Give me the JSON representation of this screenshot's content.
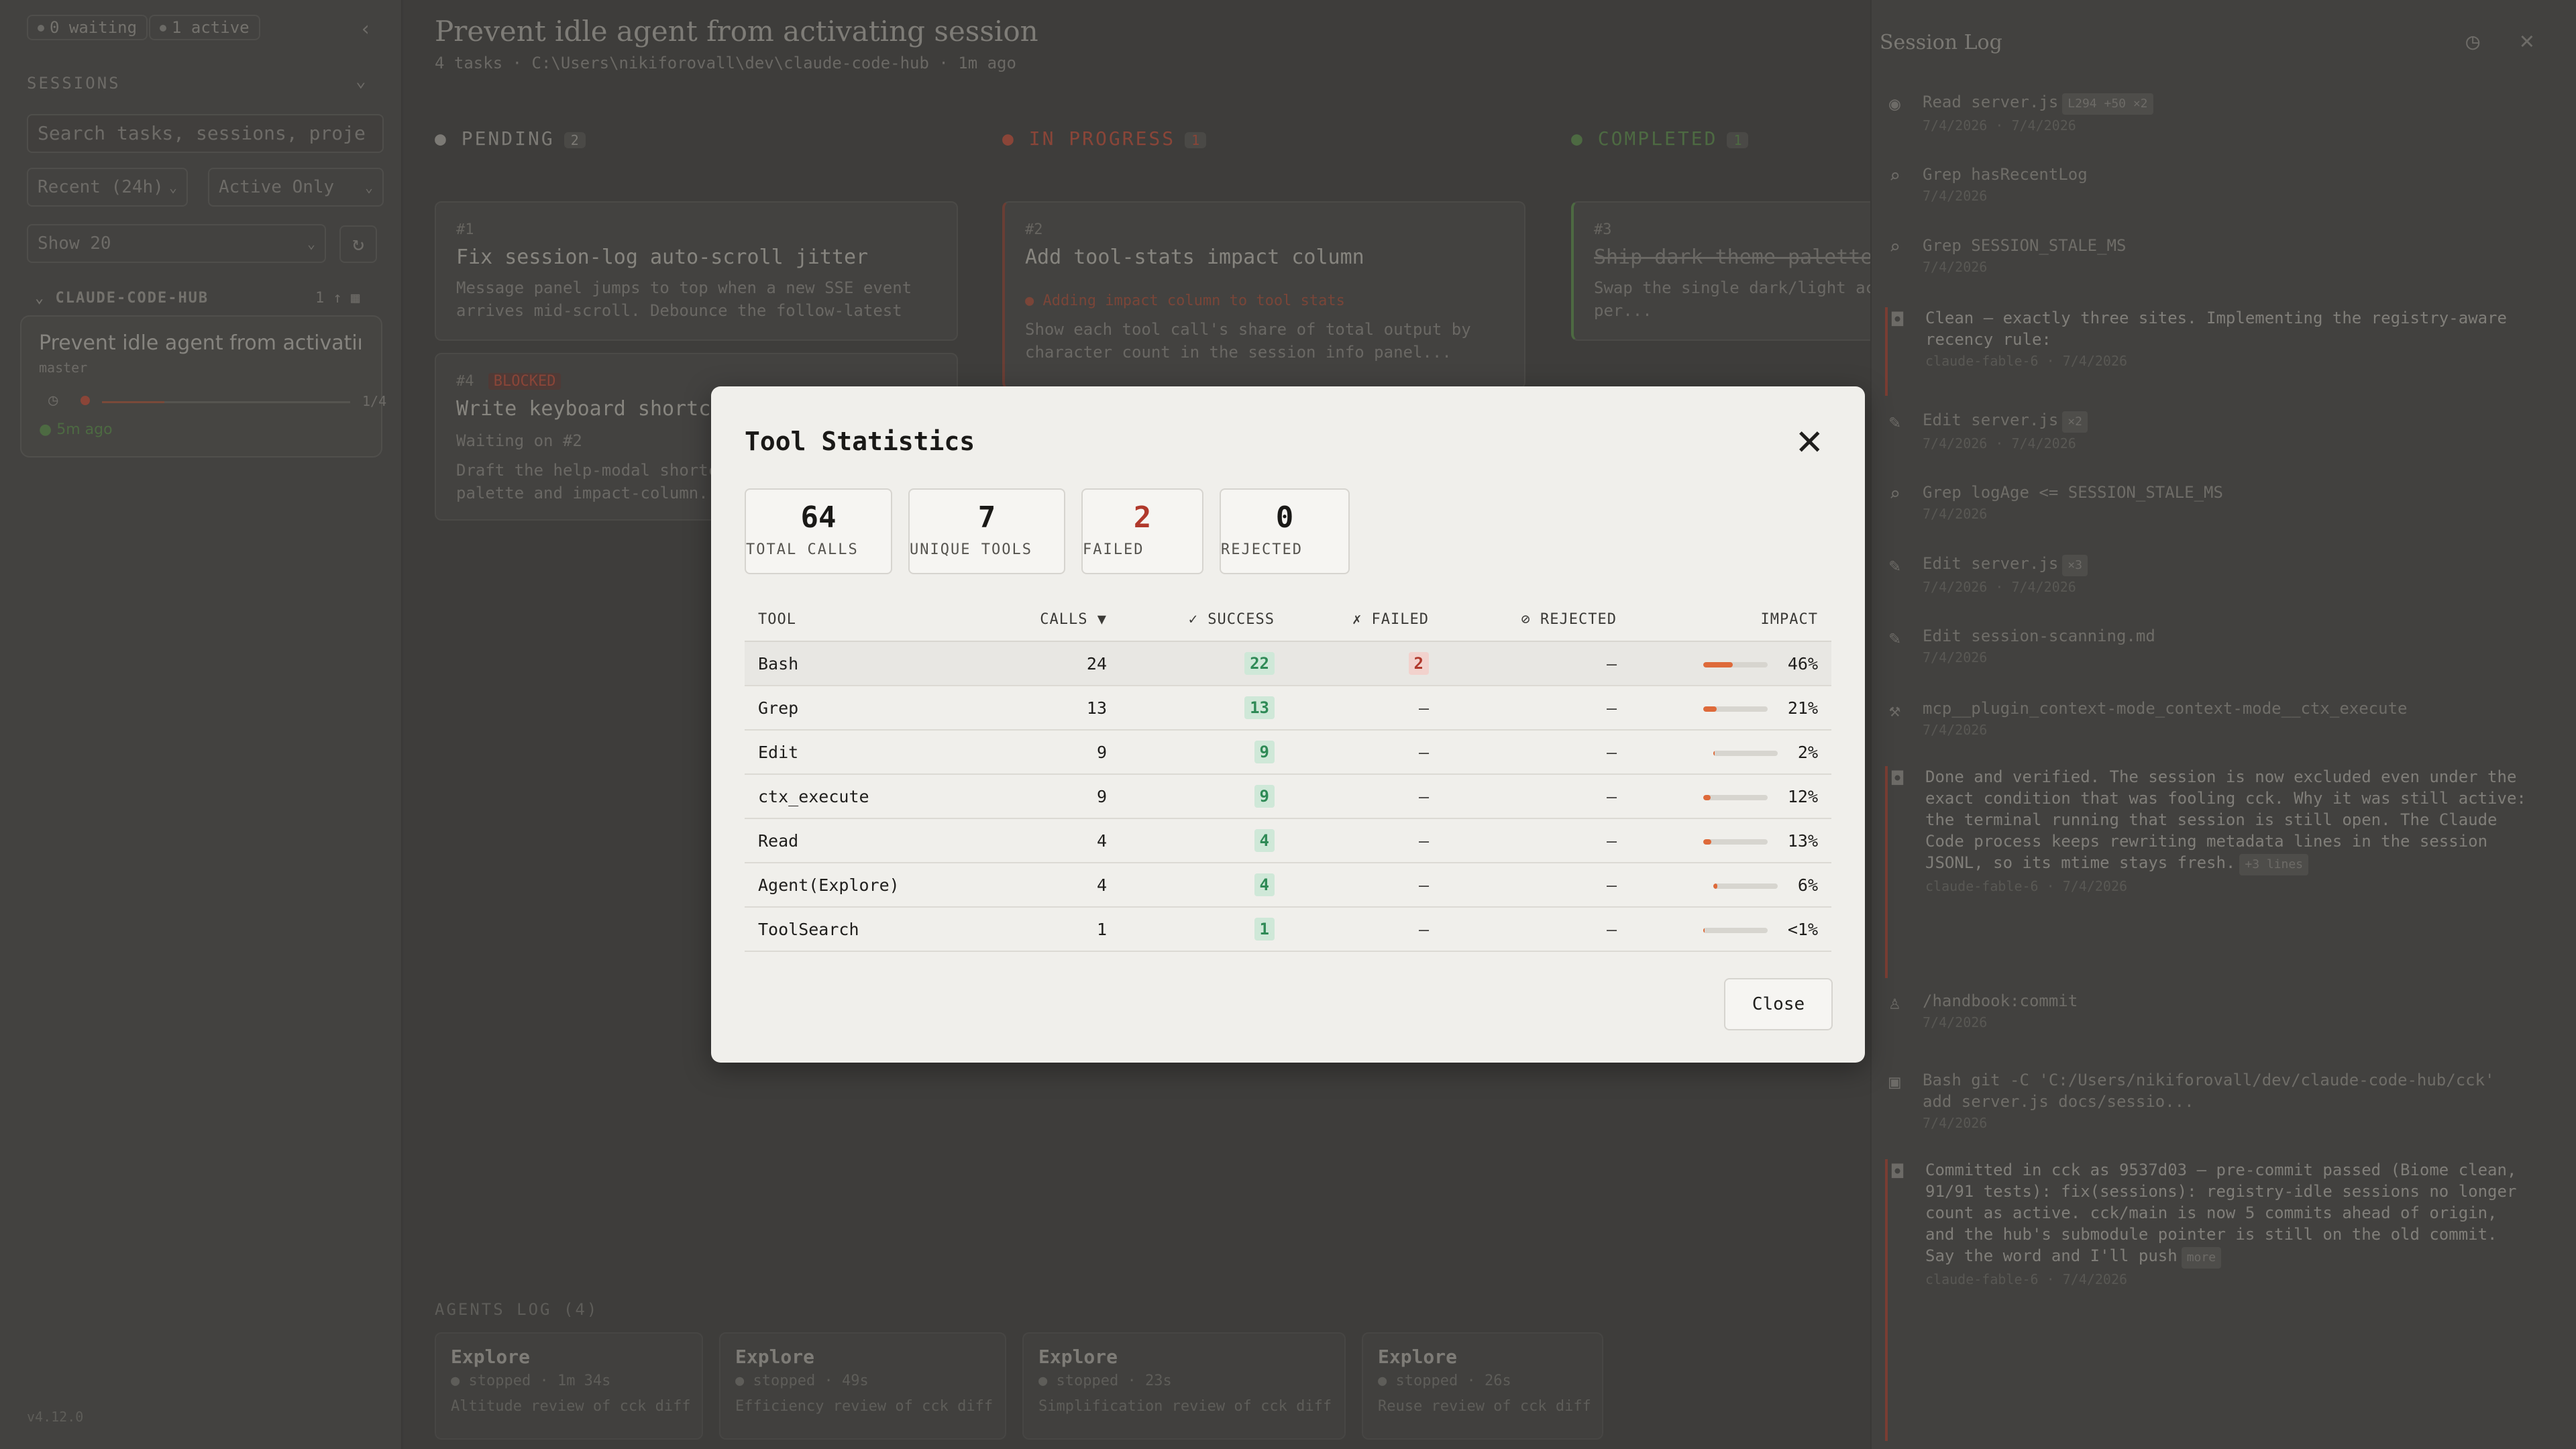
{
  "sidebar": {
    "waiting_pill": "0 waiting",
    "active_pill": "1 active",
    "section_label": "SESSIONS",
    "search_placeholder": "Search tasks, sessions, proje",
    "filter_recent": "Recent (24h)",
    "filter_active": "Active Only",
    "show_select": "Show 20",
    "project_name": "CLAUDE-CODE-HUB",
    "project_count": "1 ↑",
    "session": {
      "title": "Prevent idle agent from activatin...",
      "branch": "master",
      "progress_label": "1/4",
      "progress_fraction": 0.25,
      "ago": "5m ago"
    },
    "version": "v4.12.0"
  },
  "main": {
    "title": "Prevent idle agent from activating session",
    "subtitle": "4 tasks · C:\\Users\\nikiforovall\\dev\\claude-code-hub · 1m ago",
    "columns": [
      {
        "label": "PENDING",
        "count": "2",
        "color": "#7c7a75"
      },
      {
        "label": "IN PROGRESS",
        "count": "1",
        "color": "#8a4538"
      },
      {
        "label": "COMPLETED",
        "count": "1",
        "color": "#4d6a42"
      }
    ],
    "tasks": {
      "t1": {
        "num": "#1",
        "title": "Fix session-log auto-scroll jitter",
        "desc": "Message panel jumps to top when a new SSE event arrives mid-scroll. Debounce the follow-latest re..."
      },
      "t4": {
        "num": "#4",
        "badge": "BLOCKED",
        "title": "Write keyboard shortcut docs",
        "waiting": "Waiting on #2",
        "desc": "Draft the help-modal shortcut list for the new palette and impact-column..."
      },
      "t2": {
        "num": "#2",
        "title": "Add tool-stats impact column",
        "activity": "Adding impact column to tool stats",
        "desc": "Show each tool call's share of total output by character count in the session info panel..."
      },
      "t3": {
        "num": "#3",
        "title": "Ship dark-theme palette refresh",
        "desc": "Swap the single dark/light accent themes, persisted per..."
      }
    },
    "agents_label": "AGENTS LOG (4)",
    "agents": [
      {
        "name": "Explore",
        "status": "stopped · 1m 34s",
        "desc": "Altitude review of cck diff"
      },
      {
        "name": "Explore",
        "status": "stopped · 49s",
        "desc": "Efficiency review of cck diff"
      },
      {
        "name": "Explore",
        "status": "stopped · 23s",
        "desc": "Simplification review of cck diff"
      },
      {
        "name": "Explore",
        "status": "stopped · 26s",
        "desc": "Reuse review of cck diff"
      }
    ]
  },
  "session_log": {
    "title": "Session Log",
    "entries": [
      {
        "icon": "eye-icon",
        "glyph": "◉",
        "text": "Read server.js",
        "tag": "L294 +50  ×2",
        "meta": "7/4/2026 · 7/4/2026"
      },
      {
        "icon": "search-icon",
        "glyph": "⌕",
        "text": "Grep hasRecentLog",
        "meta": "7/4/2026"
      },
      {
        "icon": "search-icon",
        "glyph": "⌕",
        "text": "Grep SESSION_STALE_MS",
        "meta": "7/4/2026"
      },
      {
        "icon": "robot-icon",
        "glyph": "◘",
        "text": "Clean — exactly three sites. Implementing the registry-aware recency rule:",
        "meta": "claude-fable-6 · 7/4/2026",
        "highlight": true
      },
      {
        "icon": "edit-icon",
        "glyph": "✎",
        "text": "Edit server.js",
        "tag": "×2",
        "meta": "7/4/2026 · 7/4/2026"
      },
      {
        "icon": "search-icon",
        "glyph": "⌕",
        "text": "Grep logAge <= SESSION_STALE_MS",
        "meta": "7/4/2026"
      },
      {
        "icon": "edit-icon",
        "glyph": "✎",
        "text": "Edit server.js",
        "tag": "×3",
        "meta": "7/4/2026 · 7/4/2026"
      },
      {
        "icon": "edit-icon",
        "glyph": "✎",
        "text": "Edit session-scanning.md",
        "meta": "7/4/2026"
      },
      {
        "icon": "wrench-icon",
        "glyph": "⚒",
        "text": "mcp__plugin_context-mode_context-mode__ctx_execute",
        "meta": "7/4/2026"
      },
      {
        "icon": "robot-icon",
        "glyph": "◘",
        "text": "Done and verified. The session is now excluded even under the exact condition that was fooling cck. Why it was still active: the terminal running that session is still open. The Claude Code process keeps rewriting metadata lines in the session JSONL, so its mtime stays fresh.",
        "tag": "+3 lines",
        "meta": "claude-fable-6 · 7/4/2026",
        "highlight": true
      },
      {
        "icon": "user-icon",
        "glyph": "♙",
        "text": "/handbook:commit",
        "meta": "7/4/2026"
      },
      {
        "icon": "terminal-icon",
        "glyph": "▣",
        "text": "Bash git -C 'C:/Users/nikiforovall/dev/claude-code-hub/cck' add server.js docs/sessio...",
        "meta": "7/4/2026"
      },
      {
        "icon": "robot-icon",
        "glyph": "◘",
        "text": "Committed in cck as 9537d03 — pre-commit passed (Biome clean, 91/91 tests): fix(sessions): registry-idle sessions no longer count as active. cck/main is now 5 commits ahead of origin, and the hub's submodule pointer is still on the old commit. Say the word and I'll push",
        "tag": "more",
        "meta": "claude-fable-6 · 7/4/2026",
        "highlight": true
      }
    ]
  },
  "modal": {
    "title": "Tool Statistics",
    "stats": [
      {
        "value": "64",
        "label": "TOTAL CALLS"
      },
      {
        "value": "7",
        "label": "UNIQUE TOOLS"
      },
      {
        "value": "2",
        "label": "FAILED"
      },
      {
        "value": "0",
        "label": "REJECTED"
      }
    ],
    "headers": {
      "tool": "TOOL",
      "calls": "CALLS ▼",
      "success": "✓ SUCCESS",
      "failed": "✗ FAILED",
      "rejected": "⊘ REJECTED",
      "impact": "IMPACT"
    },
    "rows": [
      {
        "tool": "Bash",
        "calls": "24",
        "success": "22",
        "failed": "2",
        "rejected": "—",
        "impact": "46%",
        "impact_value": 0.46
      },
      {
        "tool": "Grep",
        "calls": "13",
        "success": "13",
        "failed": "—",
        "rejected": "—",
        "impact": "21%",
        "impact_value": 0.21
      },
      {
        "tool": "Edit",
        "calls": "9",
        "success": "9",
        "failed": "—",
        "rejected": "—",
        "impact": "2%",
        "impact_value": 0.02
      },
      {
        "tool": "ctx_execute",
        "calls": "9",
        "success": "9",
        "failed": "—",
        "rejected": "—",
        "impact": "12%",
        "impact_value": 0.12
      },
      {
        "tool": "Read",
        "calls": "4",
        "success": "4",
        "failed": "—",
        "rejected": "—",
        "impact": "13%",
        "impact_value": 0.13
      },
      {
        "tool": "Agent(Explore)",
        "calls": "4",
        "success": "4",
        "failed": "—",
        "rejected": "—",
        "impact": "6%",
        "impact_value": 0.06
      },
      {
        "tool": "ToolSearch",
        "calls": "1",
        "success": "1",
        "failed": "—",
        "rejected": "—",
        "impact": "<1%",
        "impact_value": 0.005
      }
    ],
    "close_label": "Close",
    "accent": "#de6a3a"
  }
}
